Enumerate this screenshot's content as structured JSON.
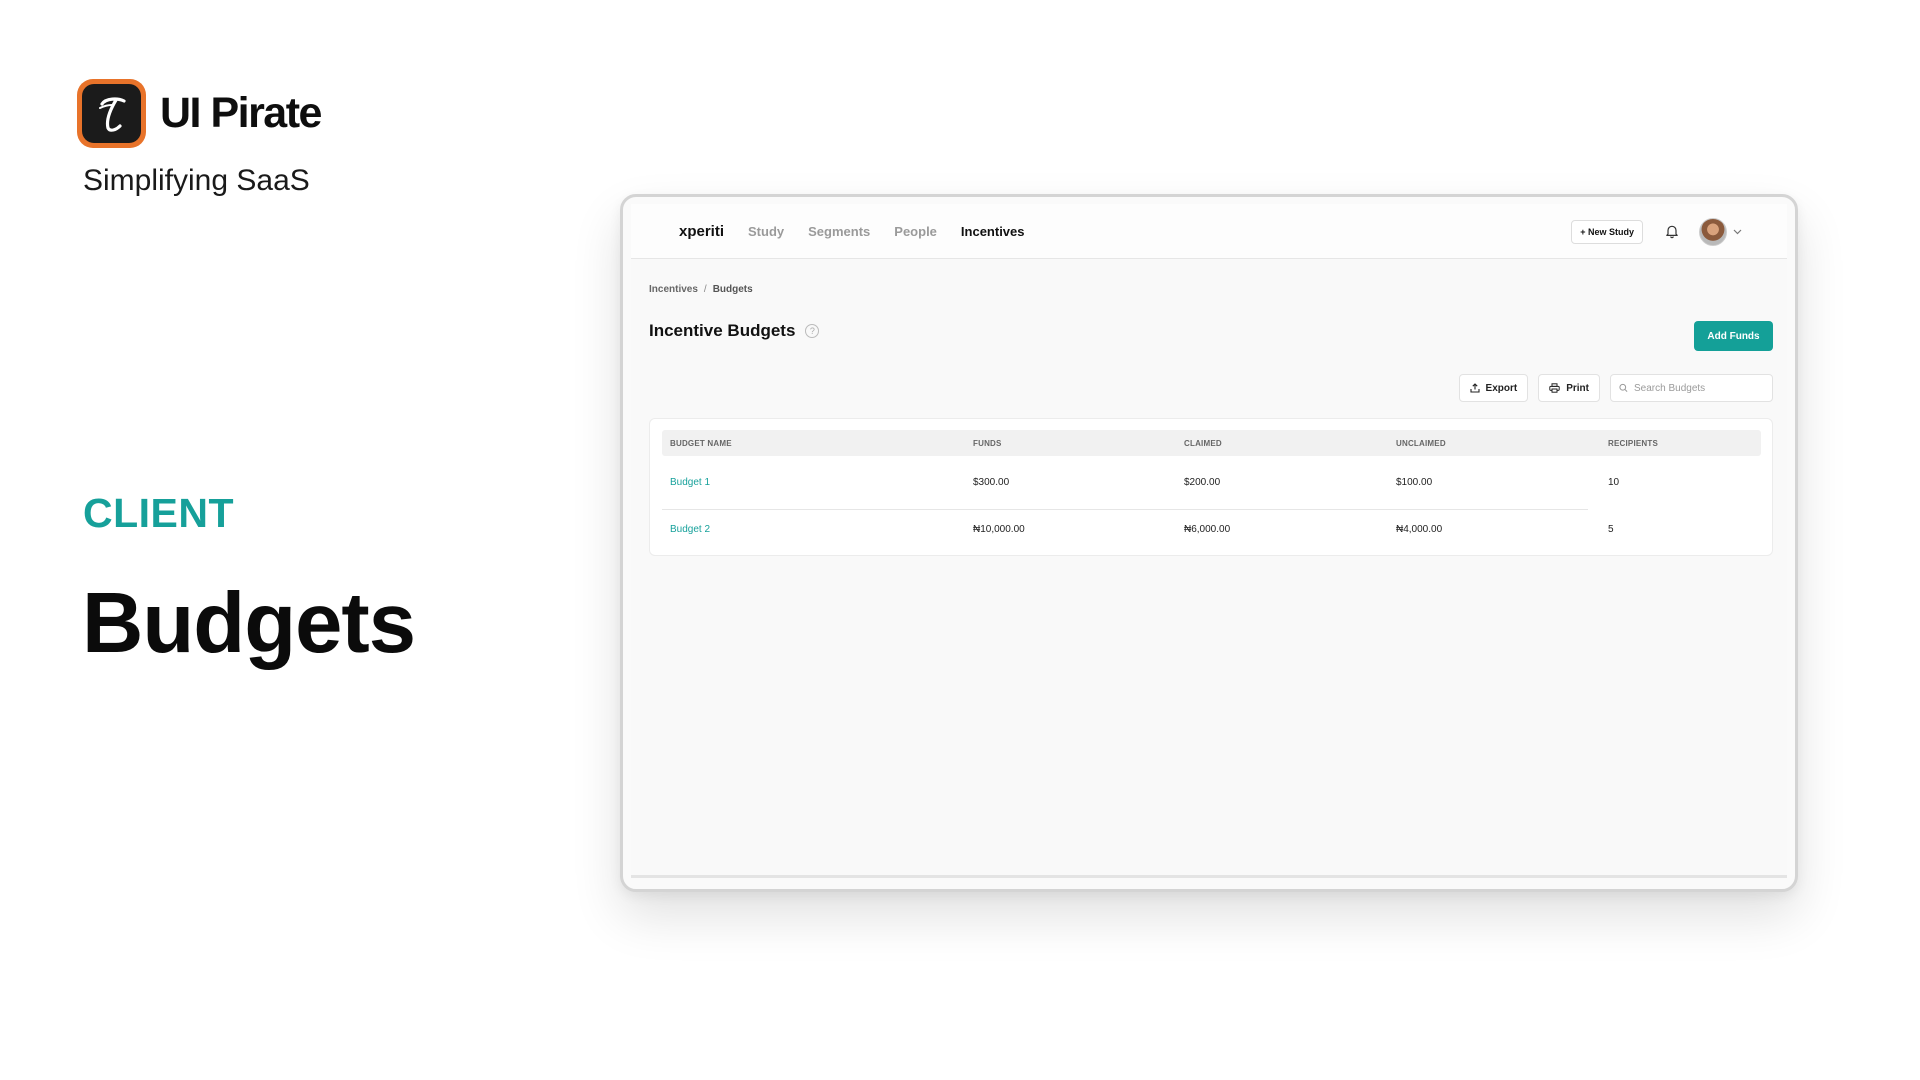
{
  "brand": {
    "name": "UI Pirate",
    "tagline": "Simplifying SaaS"
  },
  "slide": {
    "section": "CLIENT",
    "heading": "Budgets"
  },
  "app": {
    "logo": "xperiti",
    "nav": [
      {
        "label": "Study",
        "active": false
      },
      {
        "label": "Segments",
        "active": false
      },
      {
        "label": "People",
        "active": false
      },
      {
        "label": "Incentives",
        "active": true
      }
    ],
    "new_study_label": "+ New Study",
    "breadcrumb": [
      "Incentives",
      "Budgets"
    ],
    "page_title": "Incentive Budgets",
    "add_funds_label": "Add Funds",
    "toolbar": {
      "export_label": "Export",
      "print_label": "Print",
      "search_placeholder": "Search Budgets"
    },
    "table": {
      "columns": [
        "BUDGET NAME",
        "FUNDS",
        "CLAIMED",
        "UNCLAIMED",
        "RECIPIENTS"
      ],
      "rows": [
        {
          "name": "Budget 1",
          "funds": "$300.00",
          "claimed": "$200.00",
          "unclaimed": "$100.00",
          "recipients": "10"
        },
        {
          "name": "Budget 2",
          "funds": "₦10,000.00",
          "claimed": "₦6,000.00",
          "unclaimed": "₦4,000.00",
          "recipients": "5"
        }
      ]
    }
  },
  "colors": {
    "accent": "#14A098",
    "brand_orange": "#E8732A"
  },
  "icons": [
    "brand-logo-icon",
    "bell-icon",
    "avatar",
    "chevron-down-icon",
    "help-icon",
    "export-icon",
    "print-icon",
    "search-icon"
  ]
}
